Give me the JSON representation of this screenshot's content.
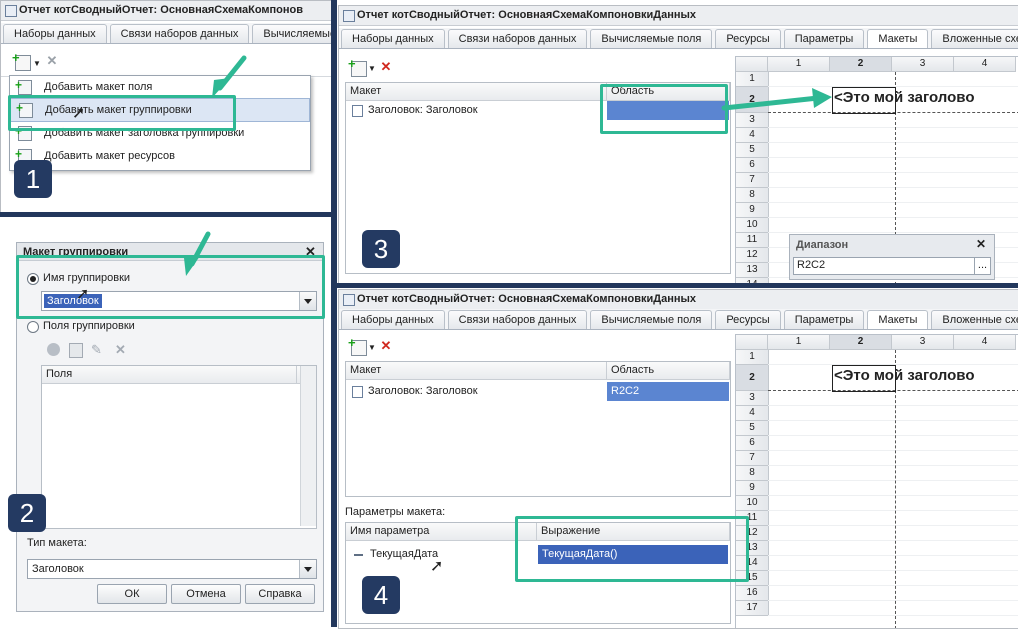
{
  "window_title": "Отчет котСводныйОтчет: ОсновнаяСхемаКомпоновкиДанных",
  "window_title_short": "Отчет котСводныйОтчет: ОсновнаяСхемаКомпонов",
  "tabs": [
    "Наборы данных",
    "Связи наборов данных",
    "Вычисляемые поля",
    "Ресурсы",
    "Параметры",
    "Макеты",
    "Вложенные схе"
  ],
  "panel1": {
    "tabs": [
      "Наборы данных",
      "Связи наборов данных",
      "Вычисляемые"
    ],
    "menu_items": [
      "Добавить макет поля",
      "Добавить макет группировки",
      "Добавить макет заголовка группировки",
      "Добавить макет ресурсов"
    ],
    "badge": "1"
  },
  "panel2": {
    "dialog_title": "Макет группировки",
    "radio_grouping_name": "Имя группировки",
    "grouping_value": "Заголовок",
    "radio_grouping_fields": "Поля группировки",
    "fields_header": "Поля",
    "layout_type_label": "Тип макета:",
    "layout_type_value": "Заголовок",
    "ok": "ОК",
    "cancel": "Отмена",
    "help": "Справка",
    "badge": "2"
  },
  "panel3": {
    "grid_headers": [
      "Макет",
      "Область"
    ],
    "row_layout": "Заголовок: Заголовок",
    "row_area": "",
    "col_headers": [
      "1",
      "2",
      "3",
      "4"
    ],
    "row_headers": [
      "1",
      "2",
      "3",
      "4",
      "5",
      "6",
      "7",
      "8",
      "9",
      "10",
      "11",
      "12",
      "13",
      "14"
    ],
    "heading_text": "<Это мой заголово",
    "range_title": "Диапазон",
    "range_value": "R2C2",
    "badge": "3"
  },
  "panel4": {
    "grid_headers": [
      "Макет",
      "Область"
    ],
    "row_layout": "Заголовок: Заголовок",
    "row_area": "R2C2",
    "col_headers": [
      "1",
      "2",
      "3",
      "4"
    ],
    "row_headers": [
      "1",
      "2",
      "3",
      "4",
      "5",
      "6",
      "7",
      "8",
      "9",
      "10",
      "11",
      "12",
      "13",
      "14",
      "15",
      "16",
      "17"
    ],
    "heading_text": "<Это мой заголово",
    "params_label": "Параметры макета:",
    "params_headers": [
      "Имя параметра",
      "Выражение"
    ],
    "param_name": "ТекущаяДата",
    "param_expr": "ТекущаяДата()",
    "badge": "4"
  },
  "colors": {
    "accent_green": "#2eb894",
    "badge": "#243a62",
    "selection": "#3b63b9"
  }
}
